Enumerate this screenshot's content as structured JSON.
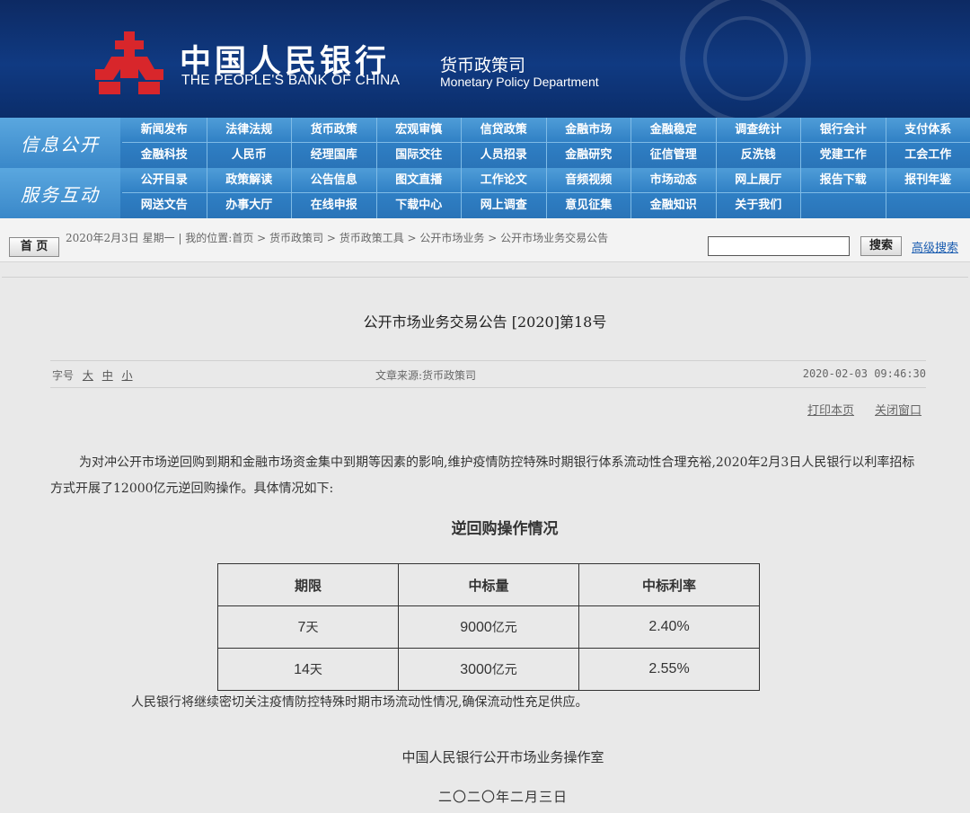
{
  "header": {
    "bank_name_cn": "中国人民银行",
    "bank_name_en": "THE PEOPLE'S BANK OF CHINA",
    "dept_cn": "货币政策司",
    "dept_en": "Monetary Policy Department",
    "logo_color": "#d8262b"
  },
  "nav": {
    "info_label": "信息公开",
    "service_label": "服务互动",
    "info_row1": [
      "新闻发布",
      "法律法规",
      "货币政策",
      "宏观审慎",
      "信贷政策",
      "金融市场",
      "金融稳定",
      "调查统计",
      "银行会计",
      "支付体系"
    ],
    "info_row2": [
      "金融科技",
      "人民币",
      "经理国库",
      "国际交往",
      "人员招录",
      "金融研究",
      "征信管理",
      "反洗钱",
      "党建工作",
      "工会工作"
    ],
    "service_row1": [
      "公开目录",
      "政策解读",
      "公告信息",
      "图文直播",
      "工作论文",
      "音频视频",
      "市场动态",
      "网上展厅",
      "报告下载",
      "报刊年鉴"
    ],
    "service_row2": [
      "网送文告",
      "办事大厅",
      "在线申报",
      "下载中心",
      "网上调查",
      "意见征集",
      "金融知识",
      "关于我们"
    ]
  },
  "breadcrumb": {
    "home_label": "首 页",
    "text": "2020年2月3日 星期一 | 我的位置:首页 > 货币政策司 > 货币政策工具 > 公开市场业务 > 公开市场业务交易公告",
    "search_value": "",
    "search_button": "搜索",
    "advanced_search": "高级搜索"
  },
  "article": {
    "title": "公开市场业务交易公告 [2020]第18号",
    "font_size_label": "字号",
    "font_sizes": [
      "大",
      "中",
      "小"
    ],
    "source": "文章来源:货币政策司",
    "datetime": "2020-02-03 09:46:30",
    "print_label": "打印本页",
    "close_label": "关闭窗口",
    "paragraph1": "为对冲公开市场逆回购到期和金融市场资金集中到期等因素的影响,维护疫情防控特殊时期银行体系流动性合理充裕,2020年2月3日人民银行以利率招标方式开展了12000亿元逆回购操作。具体情况如下:",
    "table_title": "逆回购操作情况",
    "table_headers": [
      "期限",
      "中标量",
      "中标利率"
    ],
    "table_rows": [
      {
        "term_num": "7",
        "term_unit": "天",
        "amount_num": "9000",
        "amount_unit": "亿元",
        "rate": "2.40%"
      },
      {
        "term_num": "14",
        "term_unit": "天",
        "amount_num": "3000",
        "amount_unit": "亿元",
        "rate": "2.55%"
      }
    ],
    "paragraph2": "人民银行将继续密切关注疫情防控特殊时期市场流动性情况,确保流动性充足供应。",
    "signature": "中国人民银行公开市场业务操作室",
    "sign_date": "二〇二〇年二月三日"
  }
}
